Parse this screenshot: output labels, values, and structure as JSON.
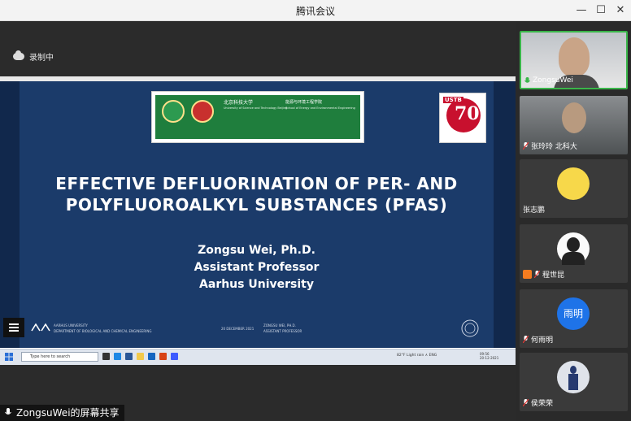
{
  "window": {
    "title": "腾讯会议",
    "controls": {
      "minimize": "—",
      "maximize": "☐",
      "close": "✕"
    }
  },
  "recording": {
    "label": "录制中"
  },
  "slide": {
    "banner_cn_univ": "北京科技大学",
    "banner_en_univ": "University of Science and Technology Beijing",
    "banner_cn_school": "能源与环境工程学院",
    "banner_en_school": "School of Energy and Environmental Engineering",
    "ustb_logo_text": "USTB",
    "ustb_logo_num": "70",
    "title_line1": "EFFECTIVE DEFLUORINATION OF PER- AND",
    "title_line2": "POLYFLUOROALKYL SUBSTANCES (PFAS)",
    "author_name": "Zongsu Wei, Ph.D.",
    "author_role": "Assistant Professor",
    "author_affil": "Aarhus University",
    "footer_univ": "AARHUS UNIVERSITY",
    "footer_dept": "DEPARTMENT OF BIOLOGICAL AND CHEMICAL ENGINEERING",
    "footer_date": "20 DECEMBER 2021",
    "footer_name": "ZONGSU WEI, PH.D.",
    "footer_role": "ASSISTANT PROFESSOR"
  },
  "os_taskbar": {
    "search_placeholder": "Type here to search",
    "tray_text": "82°F  Light rain  ∧  ENG",
    "time": "09:56",
    "date": "20-12-2021"
  },
  "share_label": "ZongsuWei的屏幕共享",
  "participants": [
    {
      "name": "ZongsuWei",
      "active": true
    },
    {
      "name": "张玲玲 北科大"
    },
    {
      "name": "张志鹏"
    },
    {
      "name": "程世昆"
    },
    {
      "name": "何雨明",
      "avatar_text": "雨明"
    },
    {
      "name": "侯荣荣"
    }
  ],
  "colors": {
    "slide_bg": "#1b3b6a",
    "active_border": "#3ab64a",
    "recording_accent": "#dddddd"
  }
}
